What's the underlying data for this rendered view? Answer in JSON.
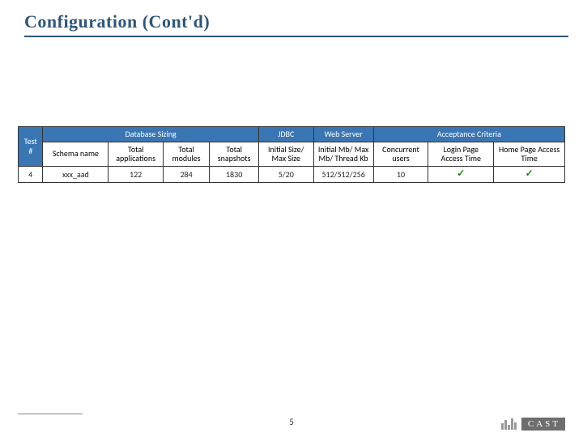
{
  "title": "Configuration (Cont'd)",
  "page_number": "5",
  "logo_text": "CAST",
  "checkmark": "✓",
  "table": {
    "sections": {
      "db_sizing": "Database Sizing",
      "jdbc": "JDBC",
      "web_server": "Web Server",
      "acceptance": "Acceptance Criteria"
    },
    "headers": {
      "test_no": "Test #",
      "schema_name": "Schema name",
      "total_applications": "Total applications",
      "total_modules": "Total modules",
      "total_snapshots": "Total snapshots",
      "initial_max_size": "Initial Size/ Max Size",
      "initial_max_thread": "Initial Mb/ Max Mb/ Thread Kb",
      "concurrent_users": "Concurrent users",
      "login_access": "Login Page Access Time",
      "home_access": "Home Page Access Time"
    },
    "row": {
      "test_no": "4",
      "schema_name": "xxx_aad",
      "total_applications": "122",
      "total_modules": "284",
      "total_snapshots": "1830",
      "initial_max_size": "5/20",
      "initial_max_thread": "512/512/256",
      "concurrent_users": "10"
    }
  },
  "chart_data": {
    "type": "table",
    "title": "Configuration (Cont'd)",
    "section_groups": [
      {
        "label": "Database Sizing",
        "columns": [
          "Schema name",
          "Total applications",
          "Total modules",
          "Total snapshots"
        ]
      },
      {
        "label": "JDBC",
        "columns": [
          "Initial Size/ Max Size"
        ]
      },
      {
        "label": "Web Server",
        "columns": [
          "Initial Mb/ Max Mb/ Thread Kb"
        ]
      },
      {
        "label": "Acceptance Criteria",
        "columns": [
          "Concurrent users",
          "Login Page Access Time",
          "Home Page Access Time"
        ]
      }
    ],
    "columns": [
      "Test #",
      "Schema name",
      "Total applications",
      "Total modules",
      "Total snapshots",
      "Initial Size/ Max Size",
      "Initial Mb/ Max Mb/ Thread Kb",
      "Concurrent users",
      "Login Page Access Time",
      "Home Page Access Time"
    ],
    "rows": [
      {
        "Test #": 4,
        "Schema name": "xxx_aad",
        "Total applications": 122,
        "Total modules": 284,
        "Total snapshots": 1830,
        "Initial Size/ Max Size": "5/20",
        "Initial Mb/ Max Mb/ Thread Kb": "512/512/256",
        "Concurrent users": 10,
        "Login Page Access Time": "pass",
        "Home Page Access Time": "pass"
      }
    ]
  }
}
